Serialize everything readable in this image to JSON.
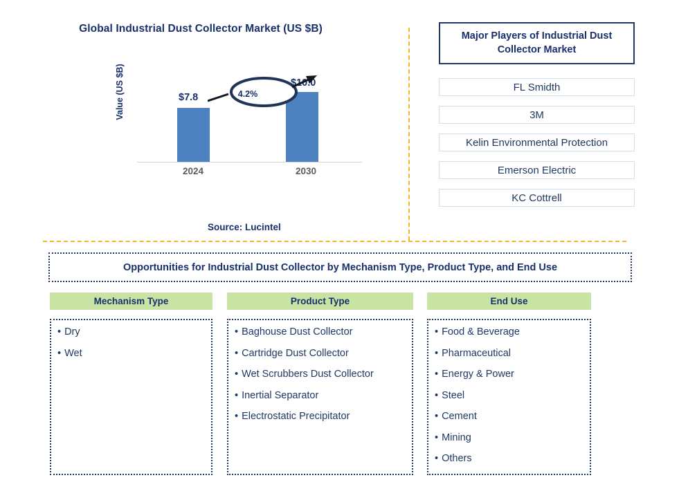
{
  "chart_data": {
    "type": "bar",
    "title": "Global Industrial Dust Collector Market (US $B)",
    "ylabel": "Value (US $B)",
    "xlabel": "",
    "categories": [
      "2024",
      "2030"
    ],
    "values": [
      7.8,
      10.0
    ],
    "value_labels": [
      "$7.8",
      "$10.0"
    ],
    "cagr_label": "4.2%",
    "ylim": [
      0,
      11.5
    ],
    "grid": false,
    "legend": "none",
    "bar_color": "#4d81bf",
    "source": "Source: Lucintel"
  },
  "players": {
    "header": "Major Players of Industrial Dust Collector Market",
    "items": [
      "FL Smidth",
      "3M",
      "Kelin Environmental Protection",
      "Emerson Electric",
      "KC Cottrell"
    ]
  },
  "opportunities": {
    "banner": "Opportunities for Industrial Dust Collector by Mechanism Type, Product Type, and End Use",
    "bullet": "•",
    "columns": [
      {
        "header": "Mechanism Type",
        "items": [
          "Dry",
          "Wet"
        ]
      },
      {
        "header": "Product Type",
        "items": [
          "Baghouse Dust Collector",
          "Cartridge Dust Collector",
          "Wet Scrubbers Dust Collector",
          "Inertial Separator",
          "Electrostatic Precipitator"
        ]
      },
      {
        "header": "End Use",
        "items": [
          "Food & Beverage",
          "Pharmaceutical",
          "Energy & Power",
          "Steel",
          "Cement",
          "Mining",
          "Others"
        ]
      }
    ]
  },
  "colors": {
    "navy": "#1f3864",
    "bar_blue": "#4d81bf",
    "header_green": "#c9e3a4",
    "divider_orange": "#f5b32c",
    "tick_gray": "#5b5b5b"
  }
}
